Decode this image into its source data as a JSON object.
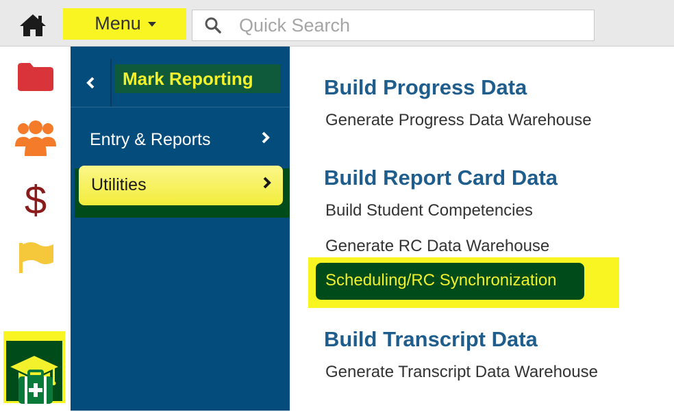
{
  "topbar": {
    "menu_label": "Menu",
    "search_placeholder": "Quick Search"
  },
  "rail": {
    "items": [
      {
        "icon": "folder-icon",
        "color": "#d9343a"
      },
      {
        "icon": "users-icon",
        "color": "#f47b2a"
      },
      {
        "icon": "dollar-icon",
        "color": "#8b1a1a"
      },
      {
        "icon": "flag-icon",
        "color": "#f5c73a"
      },
      {
        "icon": "graduation-cap-icon",
        "color": "#f2f12c",
        "active": true
      },
      {
        "icon": "medical-kit-icon",
        "color": "#0a7a3a"
      }
    ]
  },
  "subnav": {
    "title": "Mark Reporting",
    "items": [
      {
        "label": "Entry & Reports"
      },
      {
        "label": "Utilities",
        "active": true
      }
    ]
  },
  "content": {
    "sections": [
      {
        "title": "Build Progress Data",
        "links": [
          "Generate Progress Data Warehouse"
        ]
      },
      {
        "title": "Build Report Card Data",
        "links": [
          "Build Student Competencies",
          "Generate RC Data Warehouse",
          "Scheduling/RC Synchronization"
        ]
      },
      {
        "title": "Build Transcript Data",
        "links": [
          "Generate Transcript Data Warehouse"
        ]
      }
    ]
  },
  "colors": {
    "highlight_yellow": "#f8f522",
    "dark_green": "#004b1a",
    "nav_blue": "#034c7c",
    "title_blue": "#1f5d8d"
  }
}
